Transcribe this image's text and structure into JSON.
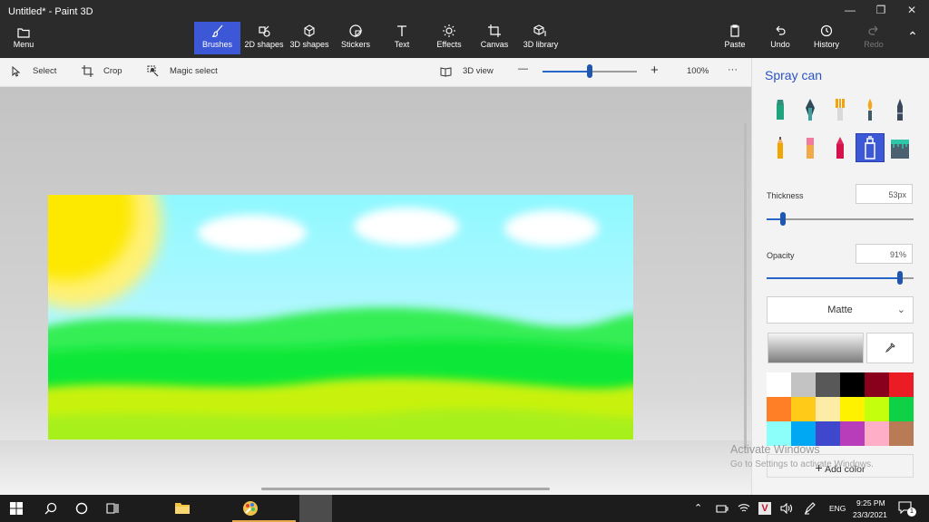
{
  "window": {
    "title": "Untitled* - Paint 3D",
    "minimize": "—",
    "maximize": "❐",
    "close": "✕"
  },
  "menu": {
    "label": "Menu"
  },
  "toolbar": {
    "items": [
      {
        "label": "Brushes",
        "active": true
      },
      {
        "label": "2D shapes"
      },
      {
        "label": "3D shapes"
      },
      {
        "label": "Stickers"
      },
      {
        "label": "Text"
      },
      {
        "label": "Effects"
      },
      {
        "label": "Canvas"
      },
      {
        "label": "3D library"
      }
    ],
    "right": [
      {
        "label": "Paste"
      },
      {
        "label": "Undo"
      },
      {
        "label": "History"
      },
      {
        "label": "Redo",
        "disabled": true
      }
    ]
  },
  "subtoolbar": {
    "select": "Select",
    "crop": "Crop",
    "magic_select": "Magic select",
    "view3d": "3D view",
    "zoom_minus": "—",
    "zoom_plus": "+",
    "zoom_value": "100%",
    "more": "···",
    "zoom_level": 0.5
  },
  "panel": {
    "title": "Spray can",
    "brushes": [
      "marker",
      "calligraphy-pen",
      "oil-brush",
      "watercolor",
      "pixel-pen",
      "pencil",
      "eraser",
      "crayon",
      "spray-can",
      "fill"
    ],
    "selected_brush": "spray-can",
    "thickness": {
      "label": "Thickness",
      "value": "53px",
      "level": 0.11
    },
    "opacity": {
      "label": "Opacity",
      "value": "91%",
      "level": 0.91
    },
    "finish": "Matte",
    "add_color": "Add color",
    "palette": [
      "#ffffff",
      "#c3c3c3",
      "#585858",
      "#000000",
      "#88001b",
      "#ec1c24",
      "#ff7f27",
      "#ffca18",
      "#fdeca6",
      "#fff200",
      "#c4ff0e",
      "#0ed145",
      "#8cfffb",
      "#00a8f3",
      "#3f48cc",
      "#b83dba",
      "#ffaec8",
      "#b97a56"
    ]
  },
  "watermark": {
    "line1": "Activate Windows",
    "line2": "Go to Settings to activate Windows."
  },
  "taskbar": {
    "time": "9:25 PM",
    "date": "23/3/2021",
    "lang": "ENG",
    "notification_count": "1"
  }
}
